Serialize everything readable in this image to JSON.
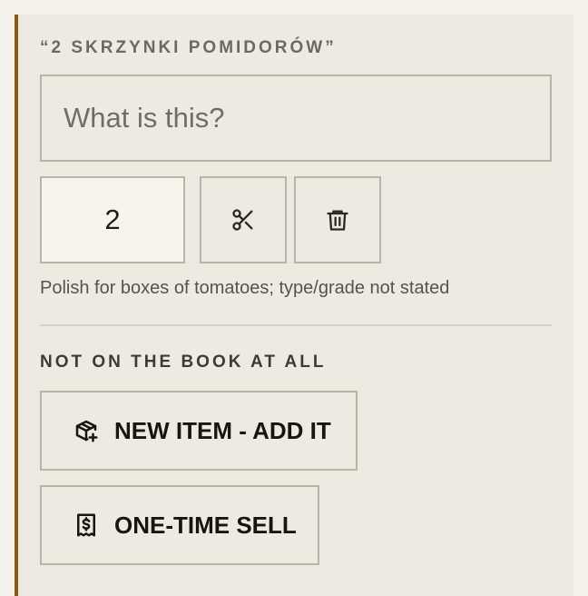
{
  "item": {
    "quote": "“2 SKRZYNKI POMIDORÓW”",
    "what_placeholder": "What is this?",
    "what_value": "",
    "quantity": "2",
    "note": "Polish for boxes of tomatoes; type/grade not stated"
  },
  "icons": {
    "split": "scissors-icon",
    "delete": "trash-icon",
    "new_item": "package-plus-icon",
    "one_time": "receipt-dollar-icon"
  },
  "section": {
    "title": "NOT ON THE BOOK AT ALL",
    "new_item_label": "NEW ITEM - ADD IT",
    "one_time_label": "ONE-TIME SELL"
  },
  "colors": {
    "accent": "#8a5a14",
    "card_bg": "#edebe1",
    "page_bg": "#f4f2eb",
    "border": "#b9b4a4"
  }
}
